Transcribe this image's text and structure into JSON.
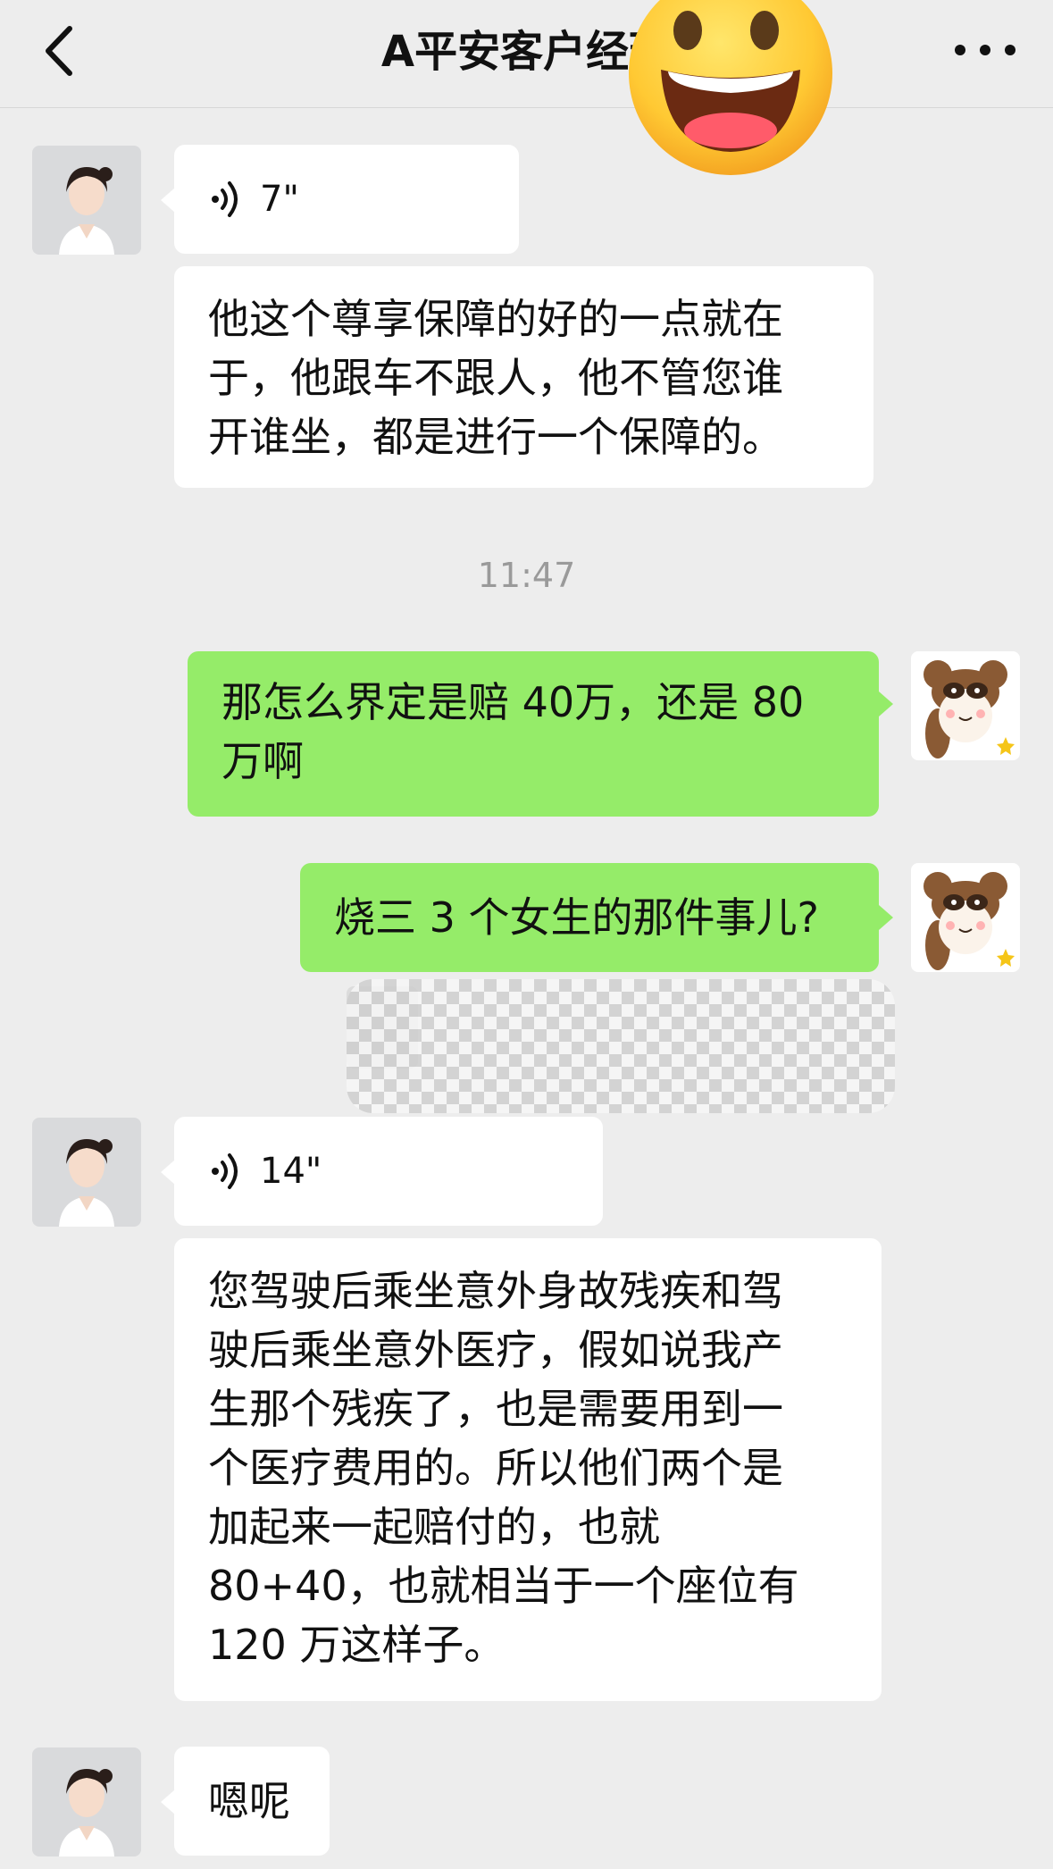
{
  "header": {
    "title": "A平安客户经理",
    "back_icon": "chevron-left-icon",
    "more_icon": "more-dots-icon"
  },
  "messages": [
    {
      "from": "contact",
      "kind": "voice",
      "duration": "7\""
    },
    {
      "from": "contact",
      "kind": "text",
      "lines": [
        "他这个尊享保障的好的一点就在",
        "于，他跟车不跟人，他不管您谁",
        "开谁坐，都是进行一个保障的。"
      ]
    },
    {
      "from": "me",
      "kind": "text",
      "lines": [
        "那怎么界定是赔 40万，还是 80",
        "万啊"
      ]
    },
    {
      "from": "me",
      "kind": "text",
      "lines": [
        "烧三 3 个女生的那件事儿?"
      ]
    },
    {
      "from": "contact",
      "kind": "voice",
      "duration": "14\""
    },
    {
      "from": "contact",
      "kind": "text",
      "lines": [
        "您驾驶后乘坐意外身故残疾和驾",
        "驶后乘坐意外医疗，假如说我产",
        "生那个残疾了，也是需要用到一",
        "个医疗费用的。所以他们两个是",
        "加起来一起赔付的，也就",
        " 80+40，也就相当于一个座位有",
        " 120 万这样子。"
      ]
    },
    {
      "from": "contact",
      "kind": "text",
      "lines": [
        "嗯呢"
      ]
    }
  ],
  "timestamp": "11:47",
  "colors": {
    "background": "#ededed",
    "incoming_bubble": "#ffffff",
    "outgoing_bubble": "#95ec69",
    "timestamp_text": "#9a9a9a"
  }
}
